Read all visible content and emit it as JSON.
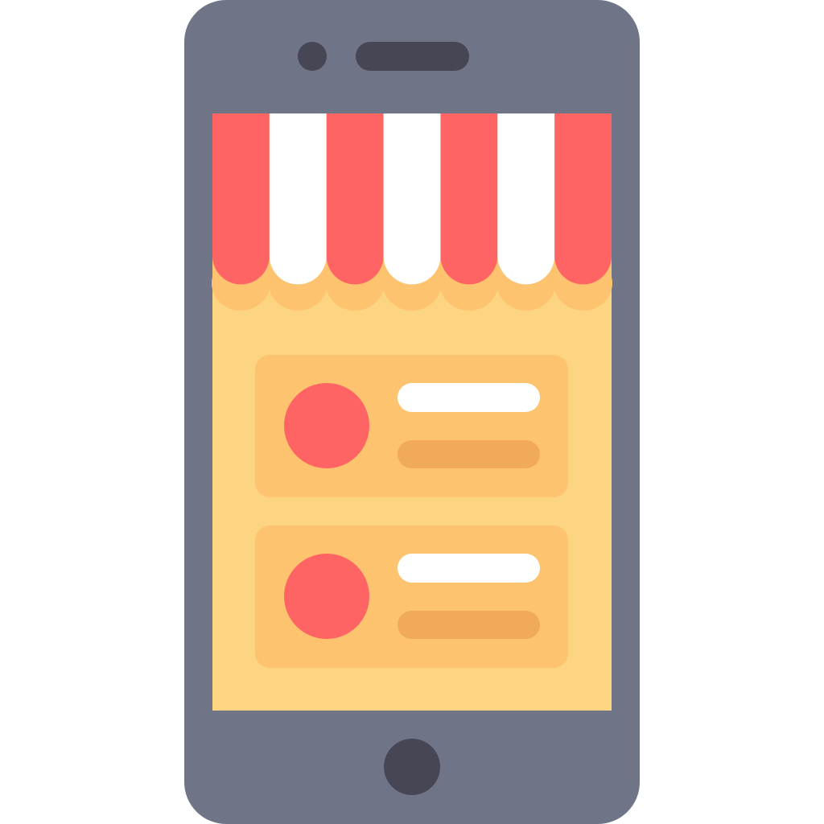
{
  "illustration": {
    "subject": "mobile-shop-app-icon",
    "colors": {
      "background": "#FFFFFF",
      "phone_body": "#707487",
      "phone_details": "#464655",
      "awning_red": "#FF6464",
      "awning_white": "#FFFFFF",
      "awning_shadow": "#FDC36E",
      "screen_bg": "#FDD582",
      "card_bg": "#FDC36E",
      "product_circle": "#FF6464",
      "title_line": "#FFFFFF",
      "subtitle_line": "#F0AA5A"
    },
    "icons": [
      "smartphone-icon",
      "store-awning-icon",
      "product-card-icon"
    ],
    "awning": {
      "stripes": [
        "red",
        "white",
        "red",
        "white",
        "red",
        "white",
        "red"
      ]
    },
    "product_cards": [
      {
        "name": "product-card-1"
      },
      {
        "name": "product-card-2"
      }
    ]
  }
}
